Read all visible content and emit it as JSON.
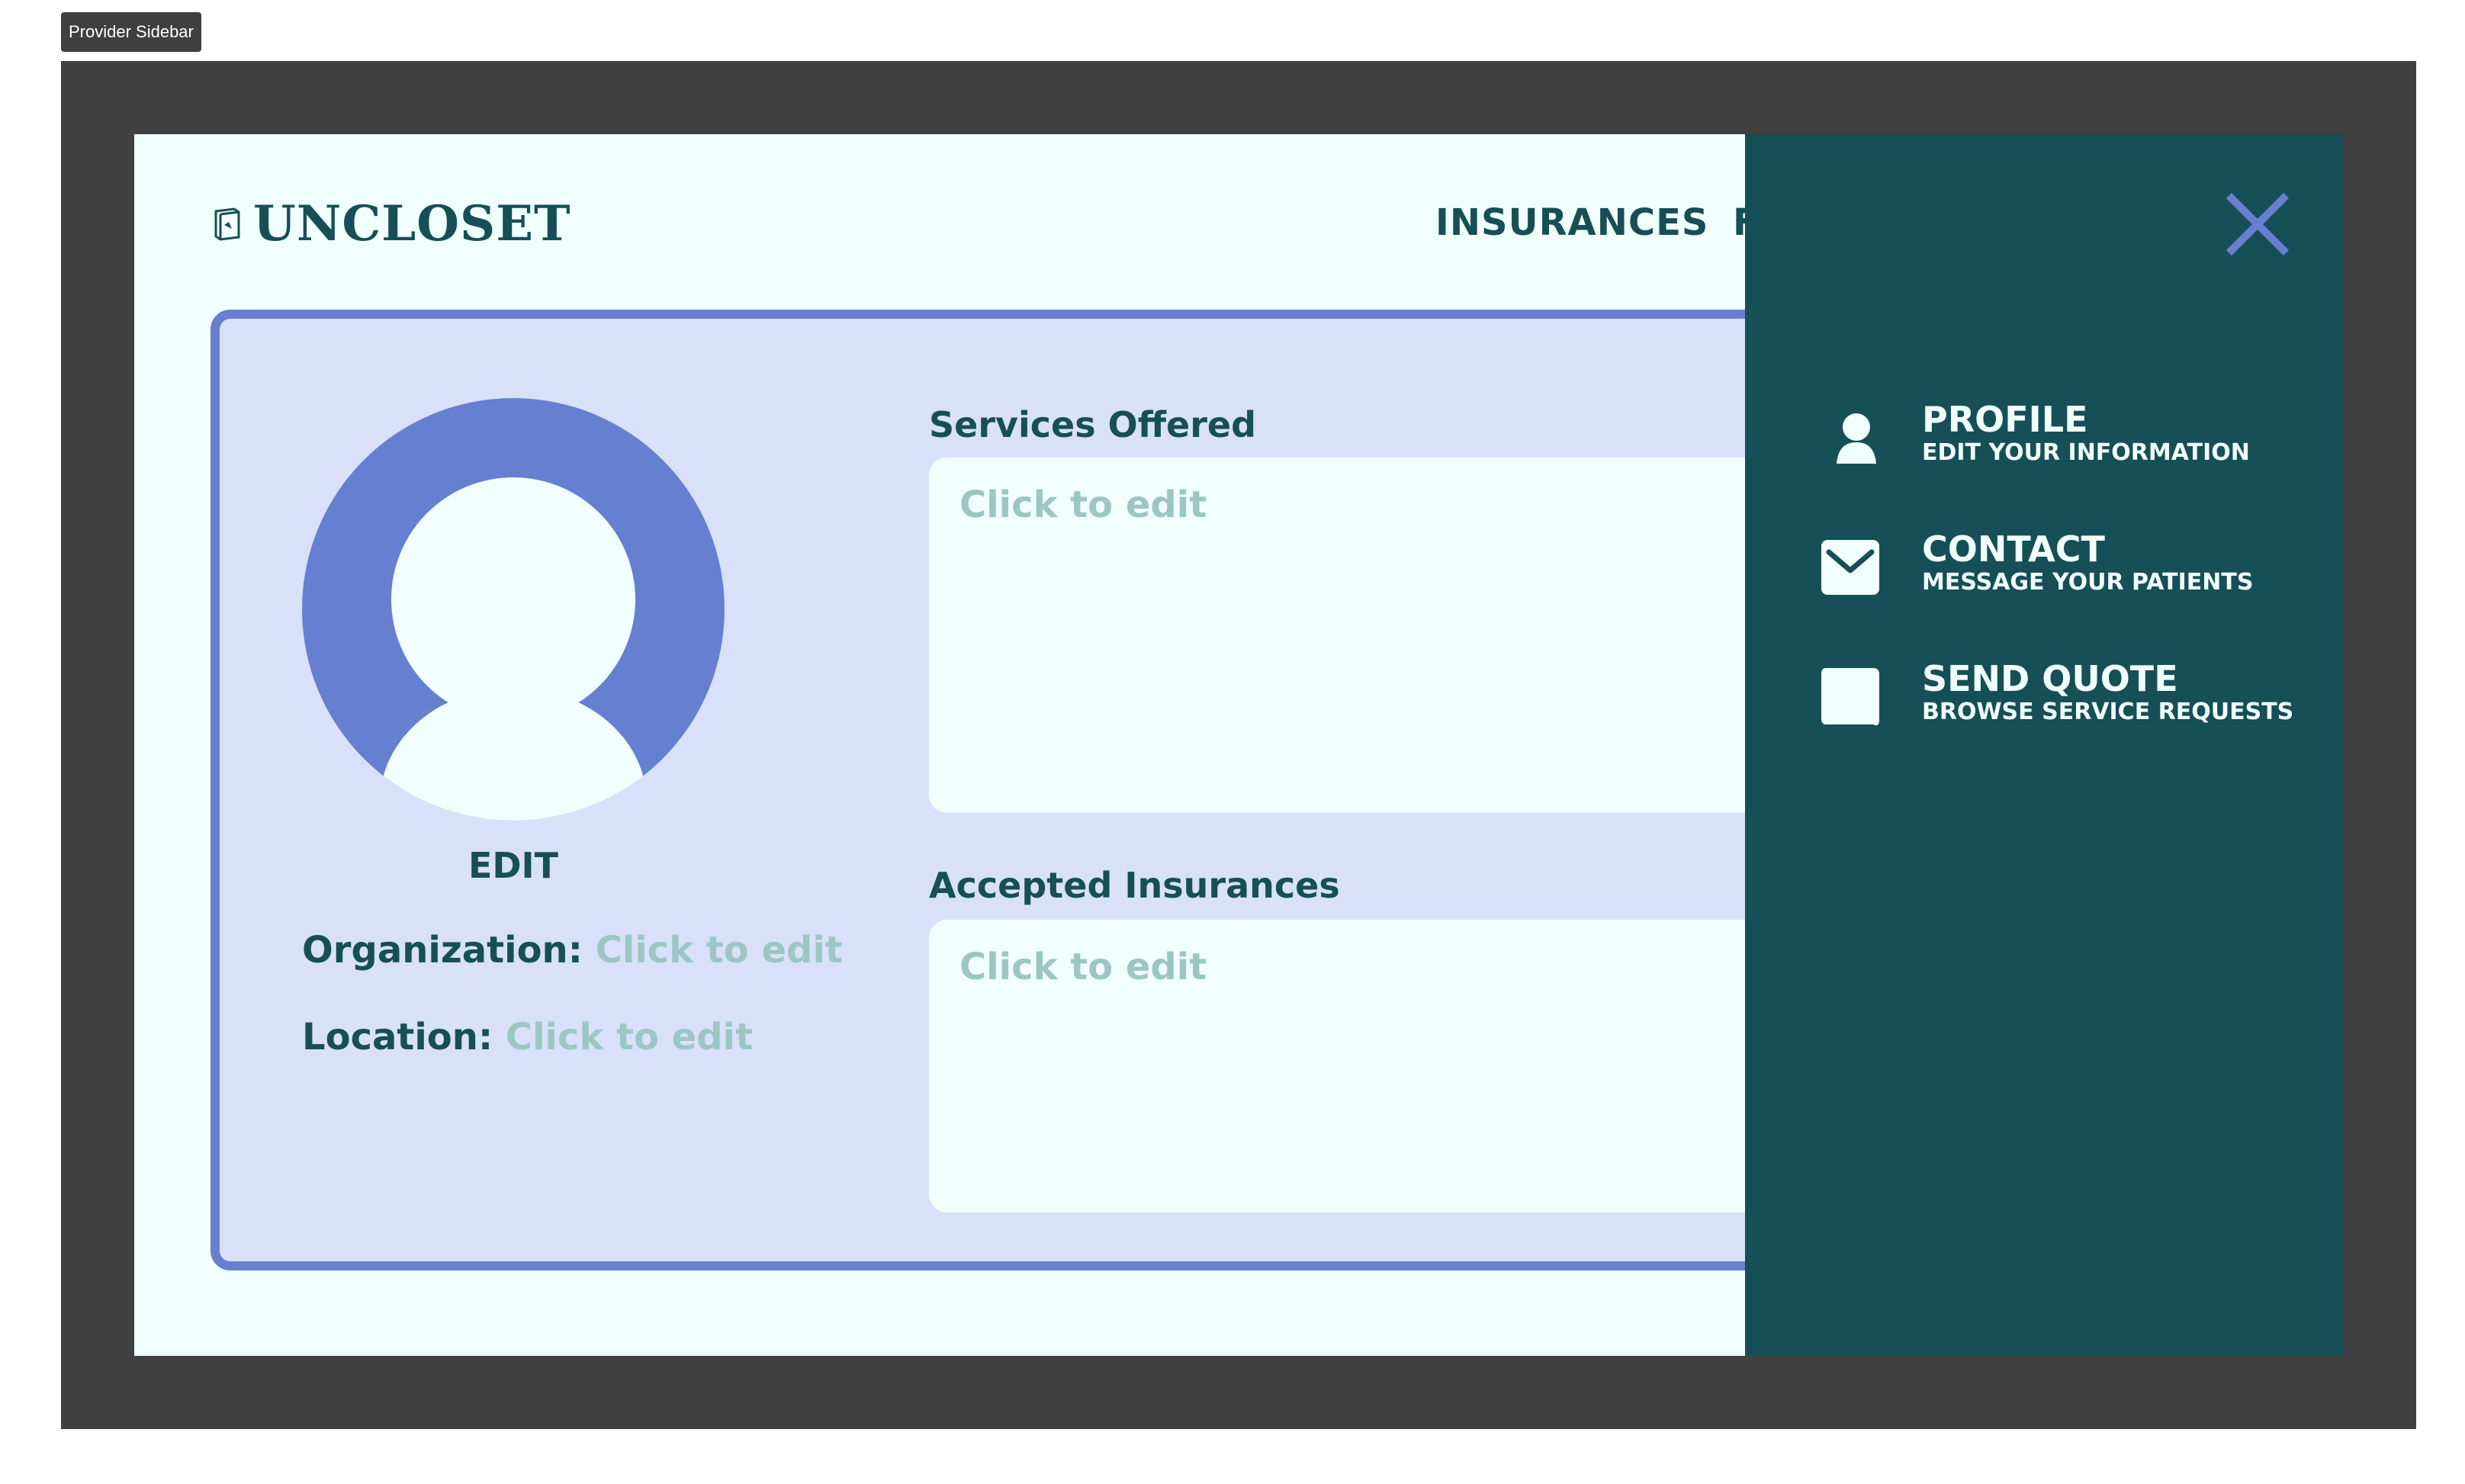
{
  "window": {
    "label": "Provider Sidebar"
  },
  "brand": {
    "name": "UNCLOSET"
  },
  "navigation": {
    "insurances": "INSURANCES",
    "partial_next": "F"
  },
  "profile": {
    "avatar_edit": "EDIT",
    "organization_label": "Organization:",
    "organization_value": "Click to edit",
    "location_label": "Location:",
    "location_value": "Click to edit"
  },
  "sections": {
    "services": {
      "title": "Services Offered",
      "placeholder": "Click to edit"
    },
    "insurances": {
      "title": "Accepted Insurances",
      "placeholder": "Click to edit"
    }
  },
  "sidebar": {
    "items": [
      {
        "title": "PROFILE",
        "subtitle": "EDIT YOUR INFORMATION",
        "icon": "person-icon"
      },
      {
        "title": "CONTACT",
        "subtitle": "MESSAGE YOUR PATIENTS",
        "icon": "envelope-icon"
      },
      {
        "title": "SEND QUOTE",
        "subtitle": "BROWSE SERVICE REQUESTS",
        "icon": "message-bubble-icon"
      }
    ]
  },
  "colors": {
    "brand_teal": "#164f55",
    "accent_blue": "#667fd0",
    "page_background": "#f0fffd",
    "card_background": "#d8e1f9",
    "placeholder_text": "#9cc6c3"
  }
}
